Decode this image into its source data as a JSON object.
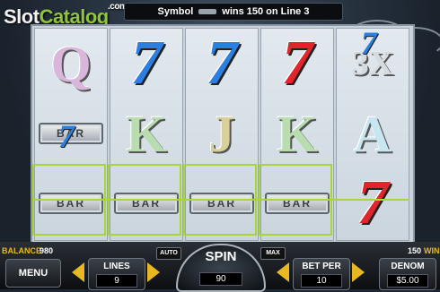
{
  "header": {
    "logo_part1": "Slot",
    "logo_part2": "Catalog",
    "logo_com": ".com",
    "message_prefix": "Symbol",
    "message_suffix": "wins 150 on Line 3"
  },
  "reels": [
    [
      "Q",
      "7 BAR",
      "BAR"
    ],
    [
      "7",
      "K",
      "BAR"
    ],
    [
      "7",
      "J",
      "BAR"
    ],
    [
      "7",
      "K",
      "BAR"
    ],
    [
      "3X",
      "A",
      "7"
    ]
  ],
  "bar_label": "BAR",
  "wild_label": "3X",
  "status": {
    "balance_label": "BALANCE",
    "balance_value": "980",
    "win_value": "150",
    "win_label": "WIN"
  },
  "controls": {
    "menu_label": "MENU",
    "lines_label": "LINES",
    "lines_value": "9",
    "auto_label": "AUTO",
    "spin_label": "SPIN",
    "spin_value": "90",
    "max_label": "MAX",
    "betper_label": "BET PER",
    "betper_value": "10",
    "denom_label": "DENOM",
    "denom_value": "$5.00"
  },
  "colors": {
    "win_highlight": "#a8d63a",
    "arrow": "#e8b820",
    "seven_blue": "#2b7fe0",
    "seven_red": "#e0262c"
  }
}
